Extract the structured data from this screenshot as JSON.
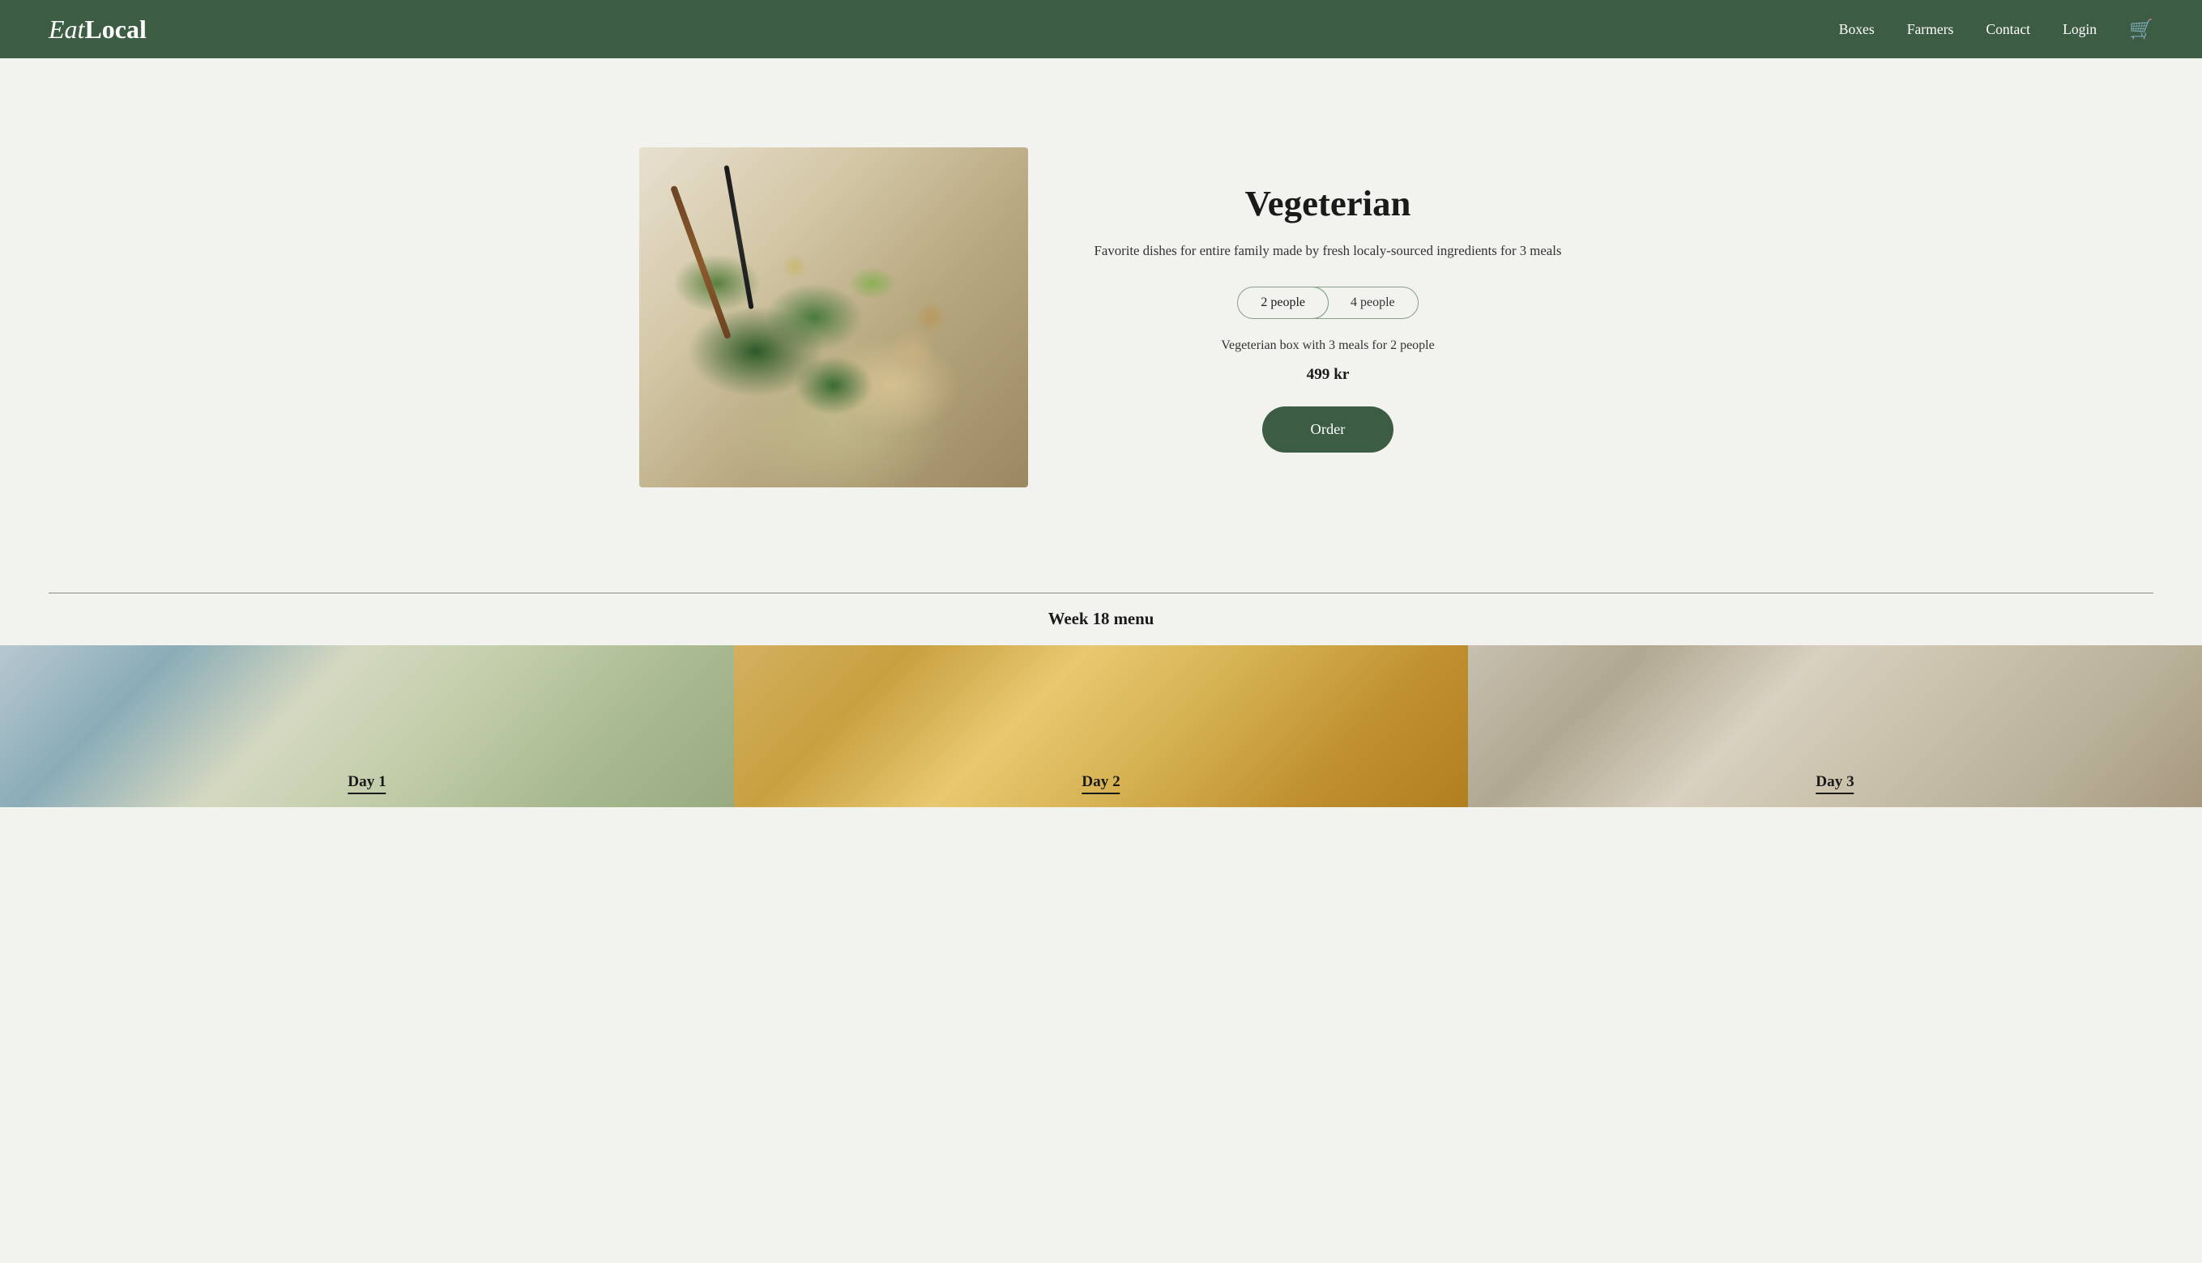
{
  "brand": {
    "logo_eat": "Eat",
    "logo_local": "Local"
  },
  "nav": {
    "boxes": "Boxes",
    "farmers": "Farmers",
    "contact": "Contact",
    "login": "Login"
  },
  "hero": {
    "title": "Vegeterian",
    "description": "Favorite dishes for entire family made by fresh localy-sourced ingredients for 3 meals",
    "people_options": [
      "2 people",
      "4 people"
    ],
    "active_option": "2 people",
    "subtitle": "Vegeterian box with 3 meals for 2 people",
    "price": "499 kr",
    "order_button": "Order"
  },
  "week_section": {
    "title": "Week 18 menu"
  },
  "days": [
    {
      "label": "Day 1"
    },
    {
      "label": "Day 2"
    },
    {
      "label": "Day 3"
    }
  ]
}
